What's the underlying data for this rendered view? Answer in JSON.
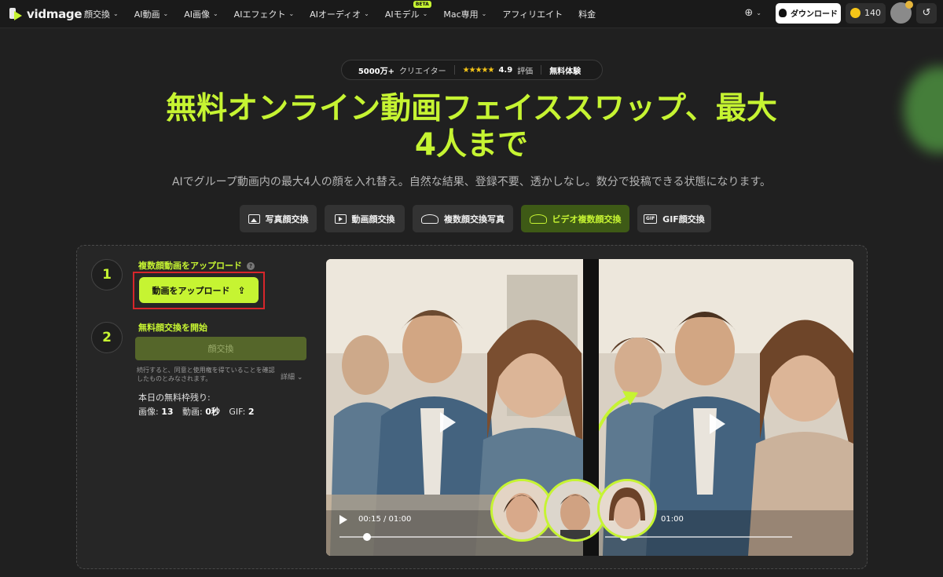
{
  "nav": {
    "logo": "vidmage",
    "items": [
      {
        "label": "顔交換",
        "chevron": true
      },
      {
        "label": "AI動画",
        "chevron": true
      },
      {
        "label": "AI画像",
        "chevron": true
      },
      {
        "label": "AIエフェクト",
        "chevron": true
      },
      {
        "label": "AIオーディオ",
        "chevron": true
      },
      {
        "label": "AIモデル",
        "chevron": true,
        "badge": "BETA"
      },
      {
        "label": "Mac専用",
        "chevron": true
      },
      {
        "label": "アフィリエイト",
        "chevron": false
      },
      {
        "label": "料金",
        "chevron": false
      }
    ],
    "download_label": "ダウンロード",
    "credits": "140"
  },
  "hero": {
    "creators_count": "5000万+",
    "creators_label": "クリエイター",
    "stars": "★★★★★",
    "rating": "4.9",
    "rating_label": "評価",
    "free_trial": "無料体験",
    "title_line1": "無料オンライン動画フェイススワップ、最大",
    "title_line2": "4人まで",
    "subtitle": "AIでグループ動画内の最大4人の顔を入れ替え。自然な結果、登録不要、透かしなし。数分で投稿できる状態になります。"
  },
  "tabs": [
    {
      "label": "写真顔交換",
      "icon": "image-icon",
      "active": false
    },
    {
      "label": "動画顔交換",
      "icon": "video-icon",
      "active": false
    },
    {
      "label": "複数顔交換写真",
      "icon": "multi-face-icon",
      "active": false
    },
    {
      "label": "ビデオ複数顔交換",
      "icon": "multi-face-video-icon",
      "active": true
    },
    {
      "label": "GIF顔交換",
      "icon": "gif-icon",
      "active": false
    }
  ],
  "steps": {
    "step1_num": "1",
    "step1_title": "複数顔動画をアップロード",
    "upload_label": "動画をアップロード",
    "step2_num": "2",
    "step2_title": "無料顔交換を開始",
    "swap_label": "顔交換",
    "terms": "続行すると、同意と使用権を得ていることを確認したものとみなされます。",
    "details_label": "詳細",
    "remaining_label": "本日の無料枠残り:",
    "image_label": "画像:",
    "image_count": "13",
    "video_label": "動画:",
    "video_count": "0秒",
    "gif_label": "GIF:",
    "gif_count": "2"
  },
  "preview": {
    "left_time": "00:15 / 01:00",
    "right_time": "01:00",
    "left_progress": 0.12,
    "right_progress": 0.1
  },
  "colors": {
    "accent": "#c6f432",
    "background": "#202020",
    "panel": "#262626",
    "highlight_border": "#d7262b"
  }
}
